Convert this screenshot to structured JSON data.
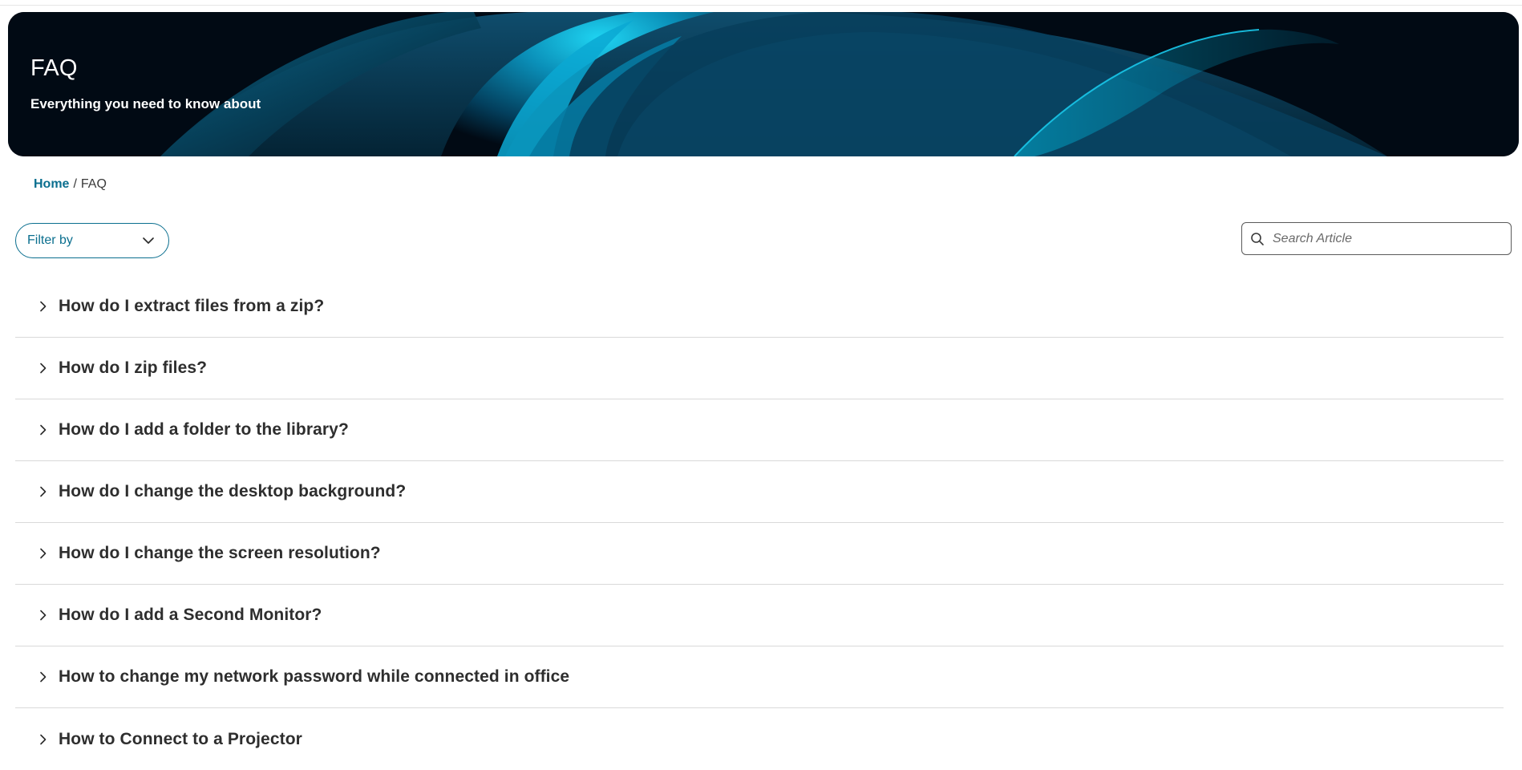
{
  "hero": {
    "title": "FAQ",
    "subtitle": "Everything you need to know about"
  },
  "breadcrumb": {
    "home": "Home",
    "separator": "/",
    "current": "FAQ"
  },
  "filter": {
    "label": "Filter by"
  },
  "search": {
    "placeholder": "Search Article"
  },
  "faq": {
    "items": [
      {
        "question": "How do I extract files from a zip?"
      },
      {
        "question": "How do I zip files?"
      },
      {
        "question": "How do I add a folder to the library?"
      },
      {
        "question": "How do I change the desktop background?"
      },
      {
        "question": "How do I change the screen resolution?"
      },
      {
        "question": "How do I add a Second Monitor?"
      },
      {
        "question": "How to change my network password while connected in office"
      },
      {
        "question": "How to Connect to a Projector"
      }
    ]
  },
  "colors": {
    "accent": "#0b6f8f",
    "hero_bg": "#010a14",
    "hero_swirl": "#12c6e8",
    "divider": "#d9d9d9"
  },
  "icons": {
    "filter": "chevron-down-icon",
    "search": "search-icon",
    "faq_item": "chevron-right-icon"
  }
}
